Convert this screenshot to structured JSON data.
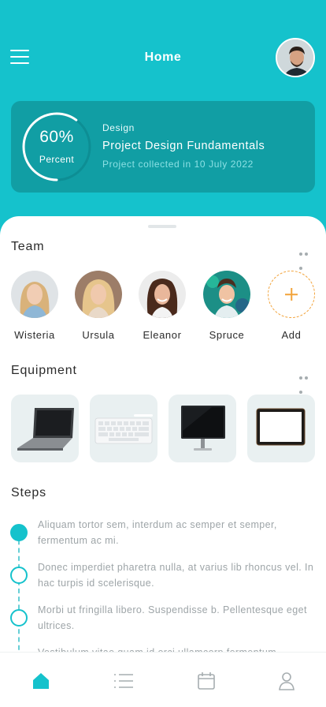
{
  "header": {
    "title": "Home",
    "menu_icon": "menu-icon",
    "avatar": "user-avatar"
  },
  "project_card": {
    "progress_percent": 60,
    "progress_value": "60%",
    "progress_label": "Percent",
    "category": "Design",
    "title": "Project Design Fundamentals",
    "subtitle": "Project collected in 10 July 2022"
  },
  "team": {
    "title": "Team",
    "more_icon": "more-horizontal-icon",
    "members": [
      {
        "name": "Wisteria"
      },
      {
        "name": "Ursula"
      },
      {
        "name": "Eleanor"
      },
      {
        "name": "Spruce"
      }
    ],
    "add_label": "Add"
  },
  "equipment": {
    "title": "Equipment",
    "more_icon": "more-horizontal-icon",
    "items": [
      "laptop-icon",
      "keyboard-icon",
      "monitor-icon",
      "tablet-icon"
    ]
  },
  "steps": {
    "title": "Steps",
    "items": [
      {
        "text": "Aliquam tortor sem, interdum ac semper et semper, fermentum ac mi.",
        "active": true
      },
      {
        "text": "Donec imperdiet pharetra nulla, at varius lib rhoncus vel. In hac turpis id scelerisque.",
        "active": false
      },
      {
        "text": "Morbi ut fringilla libero. Suspendisse b. Pellentesque eget ultrices.",
        "active": false
      },
      {
        "text": "Vestibulum vitae quam id orci ullamcorp fermentum",
        "active": false
      }
    ]
  },
  "bottom_nav": {
    "items": [
      "home-icon",
      "list-icon",
      "calendar-icon",
      "profile-icon"
    ],
    "active": "home-icon"
  },
  "colors": {
    "accent": "#15c2cc",
    "card": "#119ea4",
    "add_accent": "#f2a33a"
  }
}
